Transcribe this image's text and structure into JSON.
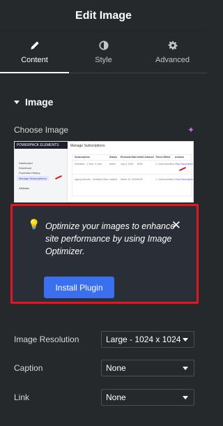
{
  "header": {
    "title": "Edit Image"
  },
  "tabs": [
    {
      "label": "Content",
      "icon": "pencil-icon",
      "active": true
    },
    {
      "label": "Style",
      "icon": "contrast-icon",
      "active": false
    },
    {
      "label": "Advanced",
      "icon": "gear-icon",
      "active": false
    }
  ],
  "section": {
    "title": "Image"
  },
  "choose_image": {
    "label": "Choose Image",
    "ai_icon": "sparkle-icon"
  },
  "thumbnail": {
    "brand": "POWERPACK ELEMENTS",
    "page_header": "Manage Subscriptions",
    "sidebar": [
      "Dashboard",
      "Download",
      "Purchase History",
      "Manage Subscriptions",
      "Affiliates"
    ],
    "columns": [
      "Subscription",
      "Status",
      "Renewal Date",
      "Initial Amount",
      "Times Billed",
      "Actions"
    ],
    "rows": [
      [
        "Unlimited - 1 Year / 1 Year",
        "active",
        "July 4, 2024",
        "$299",
        "1 / Until cancelled",
        "View Subscription"
      ],
      [
        "Agency Bundle - Unlimited Sites",
        "expired",
        "March 10, 2024",
        "$199",
        "1 / Until cancelled",
        "View Subscription"
      ]
    ]
  },
  "notice": {
    "icon": "lightbulb-icon",
    "message": "Optimize your images to enhance site performance by using Image Optimizer.",
    "button": "Install Plugin",
    "close_icon": "close-icon"
  },
  "fields": {
    "image_resolution": {
      "label": "Image Resolution",
      "value": "Large - 1024 x 1024"
    },
    "caption": {
      "label": "Caption",
      "value": "None"
    },
    "link": {
      "label": "Link",
      "value": "None"
    }
  },
  "colors": {
    "accent_button": "#3a6ff0",
    "highlight_border": "#e5161e",
    "panel_bg": "#26292c"
  }
}
